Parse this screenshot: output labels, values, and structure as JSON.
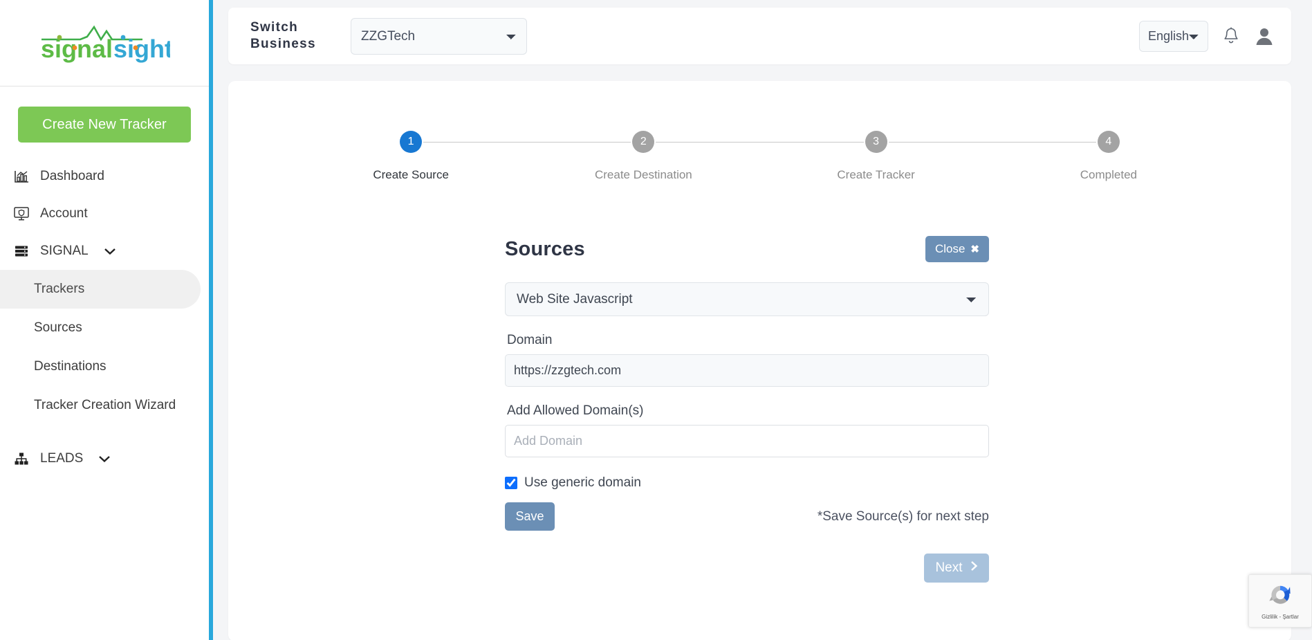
{
  "brand": {
    "name_part1": "signal",
    "name_part2": "sight",
    "color_green": "#5dbb46",
    "color_blue": "#34a7d4",
    "color_orange": "#f08a24",
    "accent_bar_color": "#29a8dc"
  },
  "sidebar": {
    "create_button": "Create New Tracker",
    "items": [
      {
        "label": "Dashboard",
        "icon": "chart-bars-icon"
      },
      {
        "label": "Account",
        "icon": "monitor-shield-icon"
      },
      {
        "label": "SIGNAL",
        "icon": "server-stack-icon",
        "caret": "chevron-down-icon"
      }
    ],
    "signal_children": [
      {
        "label": "Trackers",
        "active": true
      },
      {
        "label": "Sources",
        "active": false
      },
      {
        "label": "Destinations",
        "active": false
      },
      {
        "label": "Tracker Creation Wizard",
        "active": false
      }
    ],
    "leads": {
      "label": "LEADS",
      "icon": "sitemap-icon",
      "caret": "chevron-down-icon"
    }
  },
  "topbar": {
    "switch_business_label": "Switch Business",
    "business_value": "ZZGTech",
    "business_options": [
      "ZZGTech"
    ],
    "language_value": "English",
    "language_options": [
      "English"
    ],
    "bell_icon": "bell-icon",
    "avatar_icon": "user-avatar-icon"
  },
  "stepper": {
    "steps": [
      {
        "number": "1",
        "label": "Create Source",
        "state": "active"
      },
      {
        "number": "2",
        "label": "Create Destination",
        "state": "inactive"
      },
      {
        "number": "3",
        "label": "Create Tracker",
        "state": "inactive"
      },
      {
        "number": "4",
        "label": "Completed",
        "state": "inactive"
      }
    ],
    "active_color": "#1878d2",
    "inactive_color": "#a3a3a3"
  },
  "form": {
    "title": "Sources",
    "close_label": "Close",
    "close_icon": "close-x-icon",
    "source_type_value": "Web Site Javascript",
    "source_type_options": [
      "Web Site Javascript"
    ],
    "domain_label": "Domain",
    "domain_value": "https://zzgtech.com",
    "allowed_domains_label": "Add Allowed Domain(s)",
    "allowed_domains_value": "",
    "allowed_domains_placeholder": "Add Domain",
    "generic_domain_label": "Use generic domain",
    "generic_domain_checked": true,
    "save_label": "Save",
    "save_note": "*Save Source(s) for next step",
    "next_label": "Next",
    "next_icon": "chevron-right-icon",
    "button_color": "#6b8fb5",
    "next_button_color": "#a8c2dc"
  },
  "recaptcha": {
    "text": "Gizlilik - Şartlar",
    "logo": "recaptcha-logo-icon"
  }
}
